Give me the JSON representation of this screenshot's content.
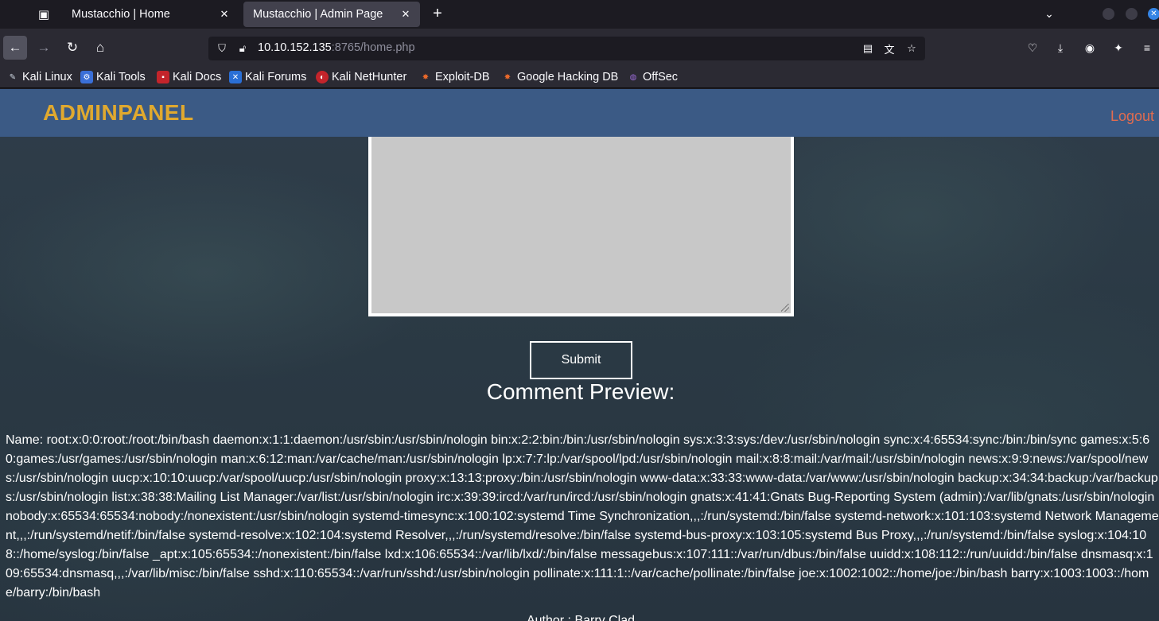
{
  "browser": {
    "tabs": [
      {
        "title": "Mustacchio | Home",
        "active": false
      },
      {
        "title": "Mustacchio | Admin Page",
        "active": true
      }
    ],
    "url": {
      "host": "10.10.152.135",
      "rest": ":8765/home.php"
    },
    "bookmarks": [
      {
        "label": "Kali Linux",
        "icon": "kali-dragon-icon"
      },
      {
        "label": "Kali Tools",
        "icon": "kali-tools-icon"
      },
      {
        "label": "Kali Docs",
        "icon": "kali-docs-icon"
      },
      {
        "label": "Kali Forums",
        "icon": "kali-forums-icon"
      },
      {
        "label": "Kali NetHunter",
        "icon": "nethunter-icon"
      },
      {
        "label": "Exploit-DB",
        "icon": "exploit-db-icon"
      },
      {
        "label": "Google Hacking DB",
        "icon": "ghdb-icon"
      },
      {
        "label": "OffSec",
        "icon": "offsec-icon"
      }
    ],
    "colors": {
      "tabbar": "#1c1b22",
      "toolbar": "#2b2a33",
      "active_tab": "#42414d"
    }
  },
  "page": {
    "brand": "ADMINPANEL",
    "logout": "Logout",
    "submit_label": "Submit",
    "preview_title": "Comment Preview:",
    "preview_text": "Name: root:x:0:0:root:/root:/bin/bash daemon:x:1:1:daemon:/usr/sbin:/usr/sbin/nologin bin:x:2:2:bin:/bin:/usr/sbin/nologin sys:x:3:3:sys:/dev:/usr/sbin/nologin sync:x:4:65534:sync:/bin:/bin/sync games:x:5:60:games:/usr/games:/usr/sbin/nologin man:x:6:12:man:/var/cache/man:/usr/sbin/nologin lp:x:7:7:lp:/var/spool/lpd:/usr/sbin/nologin mail:x:8:8:mail:/var/mail:/usr/sbin/nologin news:x:9:9:news:/var/spool/news:/usr/sbin/nologin uucp:x:10:10:uucp:/var/spool/uucp:/usr/sbin/nologin proxy:x:13:13:proxy:/bin:/usr/sbin/nologin www-data:x:33:33:www-data:/var/www:/usr/sbin/nologin backup:x:34:34:backup:/var/backups:/usr/sbin/nologin list:x:38:38:Mailing List Manager:/var/list:/usr/sbin/nologin irc:x:39:39:ircd:/var/run/ircd:/usr/sbin/nologin gnats:x:41:41:Gnats Bug-Reporting System (admin):/var/lib/gnats:/usr/sbin/nologin nobody:x:65534:65534:nobody:/nonexistent:/usr/sbin/nologin systemd-timesync:x:100:102:systemd Time Synchronization,,,:/run/systemd:/bin/false systemd-network:x:101:103:systemd Network Management,,,:/run/systemd/netif:/bin/false systemd-resolve:x:102:104:systemd Resolver,,,:/run/systemd/resolve:/bin/false systemd-bus-proxy:x:103:105:systemd Bus Proxy,,,:/run/systemd:/bin/false syslog:x:104:108::/home/syslog:/bin/false _apt:x:105:65534::/nonexistent:/bin/false lxd:x:106:65534::/var/lib/lxd/:/bin/false messagebus:x:107:111::/var/run/dbus:/bin/false uuidd:x:108:112::/run/uuidd:/bin/false dnsmasq:x:109:65534:dnsmasq,,,:/var/lib/misc:/bin/false sshd:x:110:65534::/var/run/sshd:/usr/sbin/nologin pollinate:x:111:1::/var/cache/pollinate:/bin/false joe:x:1002:1002::/home/joe:/bin/bash barry:x:1003:1003::/home/barry:/bin/bash",
    "footer_partial": "Author : Barry Clad",
    "colors": {
      "header": "#3b5a85",
      "brand": "#e0a92f",
      "logout": "#e26c4f",
      "textarea": "#c8c8c8"
    }
  }
}
